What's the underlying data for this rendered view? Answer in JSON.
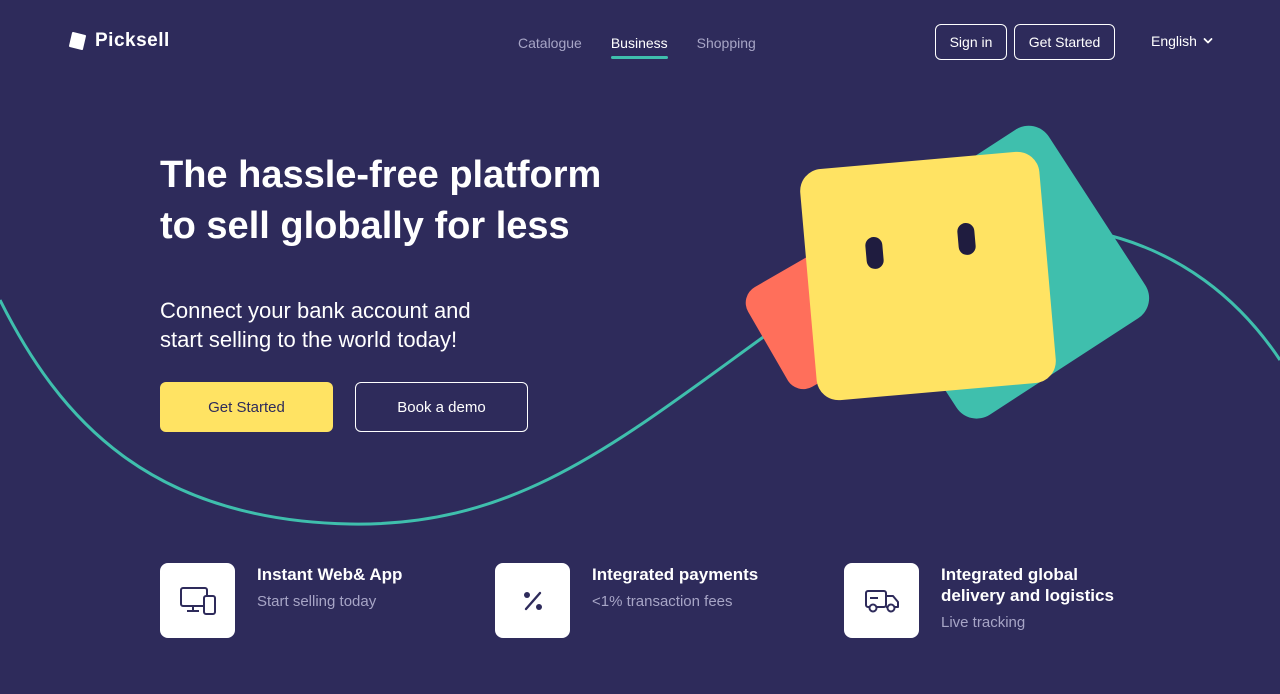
{
  "brand": {
    "name": "Picksell",
    "logo_icon": "cube-logo-icon"
  },
  "nav": {
    "items": [
      {
        "label": "Catalogue",
        "active": false
      },
      {
        "label": "Business",
        "active": true
      },
      {
        "label": "Shopping",
        "active": false
      }
    ]
  },
  "header": {
    "signin_label": "Sign in",
    "get_started_label": "Get Started",
    "language": "English",
    "language_icon": "chevron-down-icon"
  },
  "hero": {
    "title_line1": "The hassle-free platform",
    "title_line2": "to sell globally for less",
    "subtitle_line1": "Connect your bank account and",
    "subtitle_line2": "start selling to the world today!",
    "primary_cta": "Get Started",
    "secondary_cta": "Book a demo"
  },
  "features": [
    {
      "icon": "devices-icon",
      "title": "Instant Web& App",
      "description": "Start selling today"
    },
    {
      "icon": "percent-icon",
      "title": "Integrated payments",
      "description": "<1% transaction fees"
    },
    {
      "icon": "truck-icon",
      "title": "Integrated global delivery and logistics",
      "description": "Live tracking"
    }
  ],
  "colors": {
    "background": "#2e2b5b",
    "accent_teal": "#3fbfad",
    "accent_yellow": "#ffe363",
    "accent_red": "#ff6f5b",
    "muted_text": "#a7a5c6"
  }
}
